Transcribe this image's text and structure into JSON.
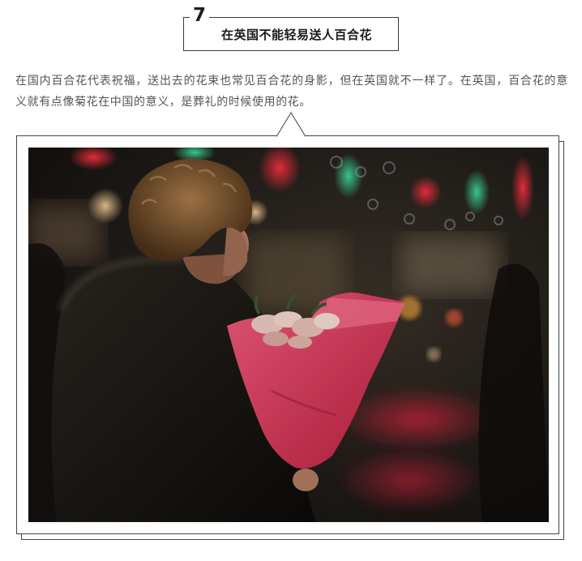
{
  "section": {
    "number": "7",
    "title": "在英国不能轻易送人百合花"
  },
  "paragraph": "在国内百合花代表祝福，送出去的花束也常见百合花的身影，但在英国就不一样了。在英国，百合花的意义就有点像菊花在中国的意义，是葬礼的时候使用的花。",
  "photo": {
    "subject": "man-holding-lily-bouquet-night-street"
  },
  "colors": {
    "text": "#555555",
    "heading": "#1a1a1a",
    "border": "#444444",
    "wrap_pink": "#e0466a"
  }
}
